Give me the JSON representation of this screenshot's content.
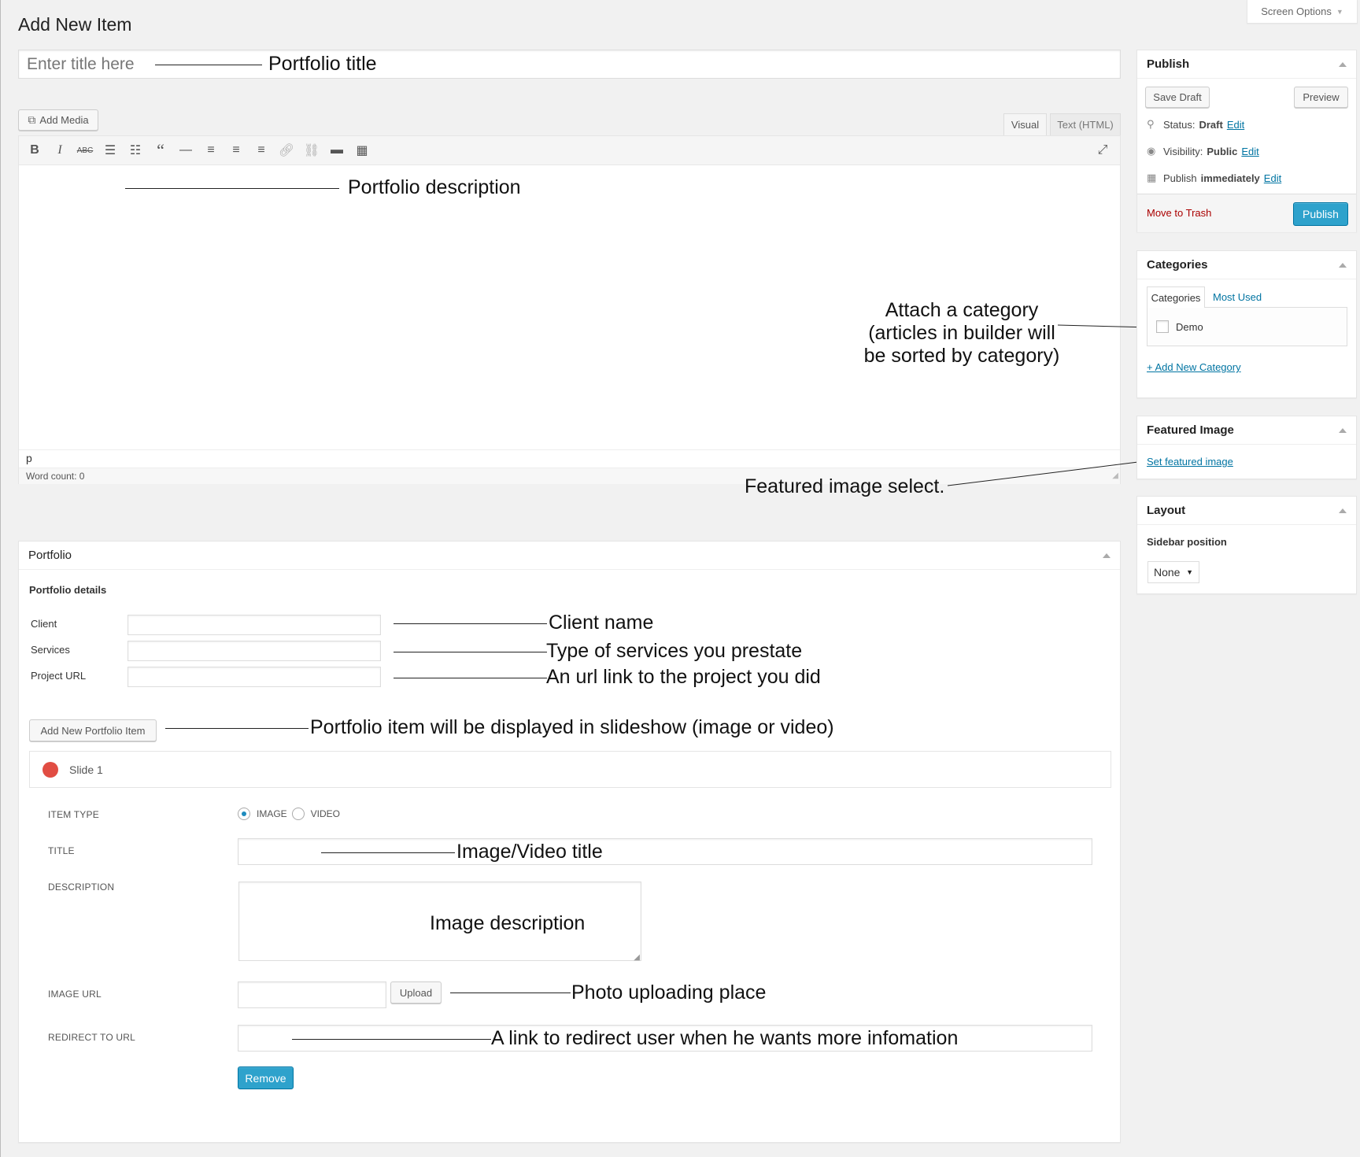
{
  "screen_options": "Screen Options",
  "page_title": "Add New Item",
  "title_input": {
    "placeholder": "Enter title here"
  },
  "editor": {
    "add_media": "Add Media",
    "tab_visual": "Visual",
    "tab_text": "Text (HTML)",
    "path": "p",
    "word_count": "Word count: 0"
  },
  "publish": {
    "title": "Publish",
    "save_draft": "Save Draft",
    "preview": "Preview",
    "status_label": "Status:",
    "status_value": "Draft",
    "visibility_label": "Visibility:",
    "visibility_value": "Public",
    "publish_label": "Publish",
    "publish_value": "immediately",
    "edit": "Edit",
    "move_to_trash": "Move to Trash",
    "publish_button": "Publish"
  },
  "categories": {
    "title": "Categories",
    "tab_all": "Categories",
    "tab_most_used": "Most Used",
    "items": [
      "Demo"
    ],
    "add_new": "+ Add New Category"
  },
  "featured_image": {
    "title": "Featured Image",
    "set_link": "Set featured image"
  },
  "layout": {
    "title": "Layout",
    "sidebar_position_label": "Sidebar position",
    "sidebar_position_value": "None"
  },
  "portfolio": {
    "title": "Portfolio",
    "details_heading": "Portfolio details",
    "fields": [
      {
        "label": "Client",
        "value": ""
      },
      {
        "label": "Services",
        "value": ""
      },
      {
        "label": "Project URL",
        "value": ""
      }
    ],
    "add_item_button": "Add New Portfolio Item",
    "slide_label": "Slide 1",
    "item_type_label": "ITEM TYPE",
    "item_type_options": [
      "IMAGE",
      "VIDEO"
    ],
    "item_type_selected": "IMAGE",
    "title_label": "TITLE",
    "description_label": "DESCRIPTION",
    "image_url_label": "IMAGE URL",
    "upload_button": "Upload",
    "redirect_label": "REDIRECT TO URL",
    "remove_button": "Remove"
  },
  "annotations": {
    "portfolio_title": "Portfolio title",
    "portfolio_description": "Portfolio description",
    "category_line1": "Attach a category",
    "category_line2": "(articles in builder will",
    "category_line3": "be sorted by category)",
    "featured_image": "Featured image select.",
    "client_name": "Client name",
    "services": "Type of services you prestate",
    "project_url": "An url link to the project you did",
    "slideshow": "Portfolio item will be displayed in slideshow (image or video)",
    "item_title": "Image/Video title",
    "image_description": "Image description",
    "photo_upload": "Photo uploading place",
    "redirect": "A link to redirect user when he wants more infomation"
  },
  "colors": {
    "primary": "#2ea2cc",
    "link": "#0074a2",
    "trash": "#a00",
    "slide_dot": "#e14d43"
  }
}
